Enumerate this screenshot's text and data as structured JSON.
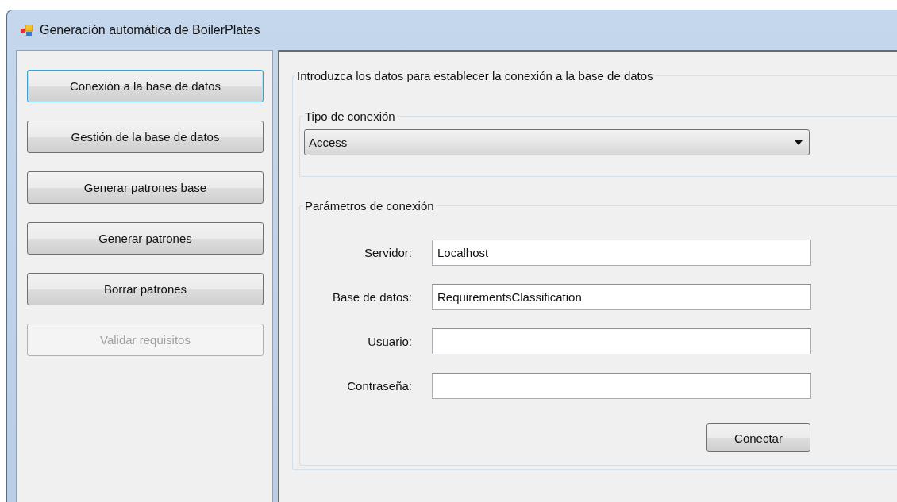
{
  "window": {
    "title": "Generación automática de BoilerPlates"
  },
  "sidebar": {
    "buttons": [
      {
        "label": "Conexión a la base de datos",
        "focused": true,
        "disabled": false
      },
      {
        "label": "Gestión de la base de datos",
        "focused": false,
        "disabled": false
      },
      {
        "label": "Generar patrones base",
        "focused": false,
        "disabled": false
      },
      {
        "label": "Generar patrones",
        "focused": false,
        "disabled": false
      },
      {
        "label": "Borrar patrones",
        "focused": false,
        "disabled": false
      },
      {
        "label": "Validar requisitos",
        "focused": false,
        "disabled": true
      }
    ]
  },
  "main": {
    "title": "Introduzca los datos para establecer la conexión a la base de datos",
    "connection_type": {
      "title": "Tipo de conexión",
      "value": "Access"
    },
    "parameters": {
      "title": "Parámetros de conexión",
      "fields": [
        {
          "label": "Servidor:",
          "value": "Localhost"
        },
        {
          "label": "Base de datos:",
          "value": "RequirementsClassification"
        },
        {
          "label": "Usuario:"
        },
        {
          "label": "Contraseña:"
        }
      ],
      "button": "Conectar"
    }
  }
}
